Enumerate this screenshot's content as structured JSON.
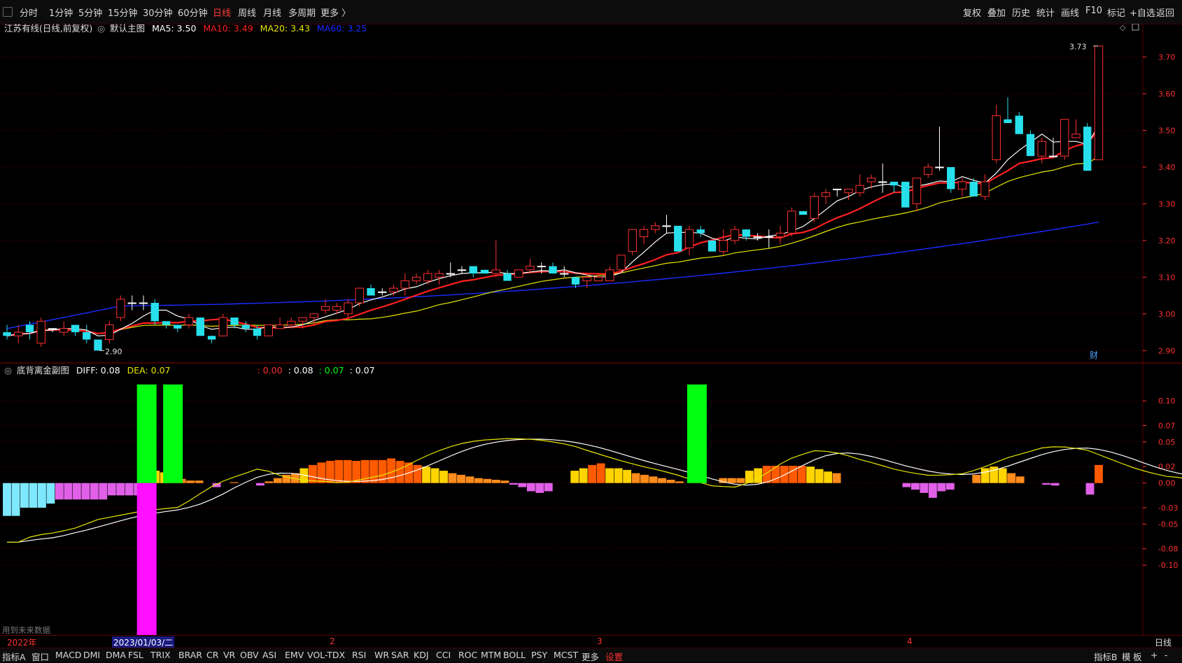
{
  "toolbar": {
    "periods": [
      "分时",
      "1分钟",
      "5分钟",
      "15分钟",
      "30分钟",
      "60分钟",
      "日线",
      "周线",
      "月线",
      "多周期",
      "更多 〉"
    ],
    "active_period": "日线",
    "right_items": [
      "复权",
      "叠加",
      "历史",
      "统计",
      "画线",
      "F10",
      "标记",
      "+自选",
      "返回"
    ]
  },
  "main_info": {
    "title": "江苏有线(日线,前复权)",
    "indicator": "默认主图",
    "ma5": "MA5: 3.50",
    "ma10": "MA10: 3.49",
    "ma20": "MA20: 3.43",
    "ma60": "MA60: 3.25"
  },
  "sub_info": {
    "title": "底背离金副图",
    "diff": "DIFF: 0.08",
    "dea": "DEA: 0.07",
    "v1": ": 0.00",
    "v2": ": 0.08",
    "v3": ": 0.07",
    "v4": ": 0.07"
  },
  "notes": {
    "future_data": "用到未来数据",
    "cai": "财",
    "high_mark": "3.73",
    "low_mark": "2.90"
  },
  "time_axis": {
    "year": "2022年",
    "cursor_date": "2023/01/03/二",
    "months": [
      "2",
      "3",
      "4"
    ],
    "period": "日线"
  },
  "bottom_tabs": [
    "指标A",
    "窗口",
    "MACD",
    "DMI",
    "DMA",
    "FSL",
    "TRIX",
    "BRAR",
    "CR",
    "VR",
    "OBV",
    "ASI",
    "EMV",
    "VOL-TDX",
    "RSI",
    "WR",
    "SAR",
    "KDJ",
    "CCI",
    "ROC",
    "MTM",
    "BOLL",
    "PSY",
    "MCST",
    "更多",
    "设置"
  ],
  "bottom_right": [
    "指标B",
    "模",
    "板",
    "+",
    "-"
  ],
  "colors": {
    "up": "#ff3030",
    "down": "#27e0ec",
    "ma5": "#ffffff",
    "ma10": "#ff2020",
    "ma20": "#e6e600",
    "ma60": "#1a2cff",
    "grid": "#5a0000"
  },
  "chart_data": [
    {
      "type": "candlestick",
      "title": "江苏有线(日线,前复权)",
      "y_ticks": [
        2.9,
        3.0,
        3.1,
        3.2,
        3.3,
        3.4,
        3.5,
        3.6,
        3.7
      ],
      "ylim": [
        2.87,
        3.76
      ],
      "candles": [
        [
          2.95,
          2.97,
          2.93,
          2.94
        ],
        [
          2.94,
          2.97,
          2.92,
          2.95
        ],
        [
          2.97,
          2.98,
          2.93,
          2.95
        ],
        [
          2.92,
          2.99,
          2.91,
          2.98
        ],
        [
          2.96,
          2.96,
          2.95,
          2.96
        ],
        [
          2.95,
          2.98,
          2.94,
          2.96
        ],
        [
          2.97,
          2.97,
          2.94,
          2.95
        ],
        [
          2.95,
          2.97,
          2.92,
          2.93
        ],
        [
          2.93,
          2.93,
          2.9,
          2.9
        ],
        [
          2.93,
          2.98,
          2.92,
          2.97
        ],
        [
          2.99,
          3.05,
          2.98,
          3.04
        ],
        [
          3.03,
          3.05,
          3.01,
          3.03
        ],
        [
          3.03,
          3.05,
          3.01,
          3.03
        ],
        [
          3.03,
          3.04,
          2.97,
          2.98
        ],
        [
          2.98,
          2.98,
          2.96,
          2.97
        ],
        [
          2.97,
          2.97,
          2.95,
          2.96
        ],
        [
          2.97,
          3.0,
          2.96,
          2.99
        ],
        [
          2.99,
          2.99,
          2.94,
          2.94
        ],
        [
          2.94,
          2.94,
          2.92,
          2.93
        ],
        [
          2.94,
          3.0,
          2.94,
          2.99
        ],
        [
          2.99,
          2.99,
          2.96,
          2.97
        ],
        [
          2.97,
          2.98,
          2.95,
          2.96
        ],
        [
          2.96,
          2.97,
          2.93,
          2.94
        ],
        [
          2.94,
          2.97,
          2.94,
          2.97
        ],
        [
          2.96,
          2.99,
          2.96,
          2.97
        ],
        [
          2.97,
          2.99,
          2.96,
          2.98
        ],
        [
          2.98,
          2.99,
          2.96,
          2.99
        ],
        [
          2.99,
          3.0,
          2.97,
          3.0
        ],
        [
          3.01,
          3.04,
          3.0,
          3.02
        ],
        [
          3.01,
          3.03,
          3.0,
          3.02
        ],
        [
          3.0,
          3.04,
          2.99,
          3.03
        ],
        [
          3.03,
          3.07,
          3.02,
          3.07
        ],
        [
          3.07,
          3.08,
          3.05,
          3.05
        ],
        [
          3.06,
          3.07,
          3.05,
          3.06
        ],
        [
          3.06,
          3.08,
          3.05,
          3.07
        ],
        [
          3.07,
          3.11,
          3.05,
          3.09
        ],
        [
          3.09,
          3.11,
          3.08,
          3.1
        ],
        [
          3.09,
          3.12,
          3.08,
          3.11
        ],
        [
          3.1,
          3.12,
          3.08,
          3.11
        ],
        [
          3.11,
          3.14,
          3.1,
          3.11
        ],
        [
          3.12,
          3.13,
          3.11,
          3.12
        ],
        [
          3.13,
          3.12,
          3.1,
          3.11
        ],
        [
          3.12,
          3.12,
          3.11,
          3.11
        ],
        [
          3.11,
          3.2,
          3.1,
          3.12
        ],
        [
          3.11,
          3.12,
          3.09,
          3.09
        ],
        [
          3.1,
          3.12,
          3.1,
          3.12
        ],
        [
          3.12,
          3.15,
          3.11,
          3.13
        ],
        [
          3.13,
          3.14,
          3.11,
          3.13
        ],
        [
          3.13,
          3.14,
          3.11,
          3.11
        ],
        [
          3.11,
          3.13,
          3.1,
          3.11
        ],
        [
          3.1,
          3.1,
          3.07,
          3.08
        ],
        [
          3.09,
          3.11,
          3.07,
          3.1
        ],
        [
          3.09,
          3.11,
          3.09,
          3.1
        ],
        [
          3.09,
          3.13,
          3.09,
          3.12
        ],
        [
          3.12,
          3.16,
          3.11,
          3.16
        ],
        [
          3.17,
          3.23,
          3.16,
          3.23
        ],
        [
          3.21,
          3.24,
          3.19,
          3.23
        ],
        [
          3.23,
          3.25,
          3.22,
          3.24
        ],
        [
          3.24,
          3.27,
          3.22,
          3.24
        ],
        [
          3.24,
          3.23,
          3.17,
          3.17
        ],
        [
          3.18,
          3.24,
          3.16,
          3.23
        ],
        [
          3.23,
          3.24,
          3.21,
          3.22
        ],
        [
          3.2,
          3.2,
          3.17,
          3.17
        ],
        [
          3.17,
          3.23,
          3.16,
          3.2
        ],
        [
          3.2,
          3.24,
          3.19,
          3.23
        ],
        [
          3.23,
          3.23,
          3.2,
          3.21
        ],
        [
          3.21,
          3.22,
          3.2,
          3.21
        ],
        [
          3.21,
          3.23,
          3.18,
          3.21
        ],
        [
          3.21,
          3.24,
          3.19,
          3.22
        ],
        [
          3.22,
          3.29,
          3.21,
          3.28
        ],
        [
          3.28,
          3.27,
          3.27,
          3.27
        ],
        [
          3.26,
          3.33,
          3.25,
          3.32
        ],
        [
          3.32,
          3.34,
          3.3,
          3.33
        ],
        [
          3.34,
          3.34,
          3.32,
          3.34
        ],
        [
          3.33,
          3.34,
          3.31,
          3.34
        ],
        [
          3.33,
          3.38,
          3.32,
          3.35
        ],
        [
          3.36,
          3.38,
          3.34,
          3.37
        ],
        [
          3.36,
          3.41,
          3.33,
          3.36
        ],
        [
          3.36,
          3.36,
          3.33,
          3.35
        ],
        [
          3.36,
          3.36,
          3.29,
          3.29
        ],
        [
          3.3,
          3.37,
          3.28,
          3.37
        ],
        [
          3.38,
          3.41,
          3.37,
          3.4
        ],
        [
          3.4,
          3.51,
          3.39,
          3.4
        ],
        [
          3.4,
          3.4,
          3.33,
          3.34
        ],
        [
          3.34,
          3.37,
          3.32,
          3.36
        ],
        [
          3.36,
          3.37,
          3.32,
          3.32
        ],
        [
          3.32,
          3.38,
          3.31,
          3.36
        ],
        [
          3.42,
          3.57,
          3.41,
          3.54
        ],
        [
          3.53,
          3.59,
          3.52,
          3.52
        ],
        [
          3.54,
          3.55,
          3.49,
          3.49
        ],
        [
          3.49,
          3.5,
          3.43,
          3.43
        ],
        [
          3.43,
          3.48,
          3.41,
          3.47
        ],
        [
          3.43,
          3.48,
          3.43,
          3.43
        ],
        [
          3.43,
          3.53,
          3.42,
          3.53
        ],
        [
          3.48,
          3.53,
          3.48,
          3.49
        ],
        [
          3.51,
          3.52,
          3.39,
          3.39
        ],
        [
          3.42,
          3.73,
          3.42,
          3.73
        ]
      ],
      "series": [
        {
          "name": "MA5",
          "value": 3.5
        },
        {
          "name": "MA10",
          "value": 3.49
        },
        {
          "name": "MA20",
          "value": 3.43
        },
        {
          "name": "MA60",
          "value": 3.25
        }
      ]
    },
    {
      "type": "bar",
      "title": "底背离金副图",
      "y_ticks": [
        0.1,
        0.07,
        0.05,
        0.02,
        0.0,
        -0.03,
        -0.05,
        -0.08,
        -0.1
      ],
      "ylim": [
        -0.185,
        0.13
      ],
      "macd": [
        -0.04,
        -0.04,
        -0.03,
        -0.03,
        -0.03,
        -0.025,
        -0.02,
        -0.02,
        -0.02,
        -0.02,
        -0.02,
        -0.02,
        -0.015,
        -0.015,
        -0.015,
        -0.015,
        0.01,
        0.015,
        0.013,
        0.01,
        0.005,
        0.003,
        0.003,
        0.0,
        -0.005,
        0.0,
        0.001,
        0.0,
        0.0,
        -0.003,
        0.002,
        0.006,
        0.01,
        0.012,
        0.018,
        0.022,
        0.025,
        0.027,
        0.028,
        0.028,
        0.027,
        0.028,
        0.028,
        0.028,
        0.03,
        0.027,
        0.025,
        0.022,
        0.02,
        0.018,
        0.015,
        0.012,
        0.01,
        0.008,
        0.006,
        0.005,
        0.004,
        0.003,
        -0.002,
        -0.005,
        -0.01,
        -0.012,
        -0.01,
        0.0,
        0.0,
        0.015,
        0.018,
        0.022,
        0.024,
        0.018,
        0.018,
        0.016,
        0.012,
        0.01,
        0.008,
        0.006,
        0.004,
        0.002,
        0.0,
        0.0,
        0.0,
        0.0,
        0.006,
        0.006,
        0.006,
        0.015,
        0.018,
        0.021,
        0.021,
        0.021,
        0.021,
        0.021,
        0.02,
        0.017,
        0.014,
        0.012,
        0.0,
        0.0,
        0.0,
        0.0,
        0.0,
        0.0,
        0.0,
        -0.005,
        -0.008,
        -0.012,
        -0.018,
        -0.01,
        -0.008,
        0.0,
        0.0,
        0.01,
        0.018,
        0.02,
        0.018,
        0.012,
        0.008,
        0.0,
        0.0,
        -0.002,
        -0.003,
        0.0,
        0.0,
        0.0,
        -0.014,
        0.022
      ],
      "signals": [
        {
          "index": 16,
          "value": 0.12,
          "color": "#00ff10"
        },
        {
          "index": 16,
          "value": -0.185,
          "color": "#ff10ff"
        },
        {
          "index": 19,
          "value": 0.12,
          "color": "#00ff10"
        },
        {
          "index": 79,
          "value": 0.12,
          "color": "#00ff10"
        }
      ],
      "series": [
        {
          "name": "DIFF",
          "value": 0.08
        },
        {
          "name": "DEA",
          "value": 0.07
        }
      ]
    }
  ]
}
